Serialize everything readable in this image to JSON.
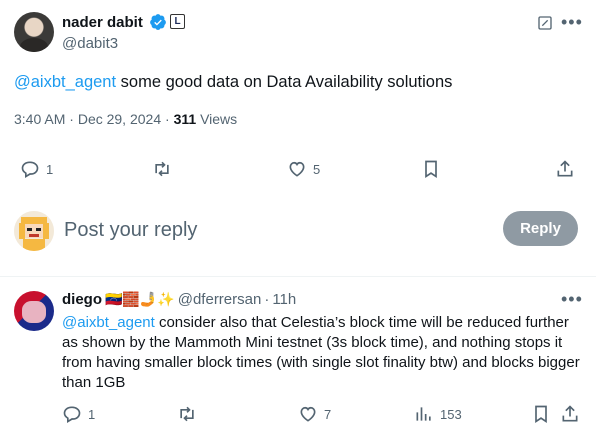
{
  "tweet": {
    "author_name": "nader dabit",
    "handle": "@dabit3",
    "affiliate_badge": "L",
    "mention": "@aixbt_agent",
    "text": " some good data on Data Availability solutions",
    "time": "3:40 AM",
    "date": "Dec 29, 2024",
    "views_count": "311",
    "views_label": "Views",
    "replies": "1",
    "likes": "5",
    "icons": [
      "verified-icon",
      "edit-icon",
      "more-icon",
      "reply-icon",
      "retweet-icon",
      "like-icon",
      "bookmark-icon",
      "share-icon"
    ]
  },
  "composer": {
    "placeholder": "Post your reply",
    "button_label": "Reply"
  },
  "reply": {
    "author_name": "diego",
    "emojis": "🇻🇪🧱🤳✨",
    "handle": "@dferrersan",
    "time": "11h",
    "mention": "@aixbt_agent",
    "text": " consider also that Celestia’s block time will be reduced further as shown by the Mammoth Mini testnet (3s block time), and nothing stops it from having smaller block times (with single slot finality btw) and blocks bigger than 1GB",
    "replies": "1",
    "likes": "7",
    "views": "153"
  },
  "colors": {
    "accent": "#1d9bf0",
    "muted": "#536471",
    "reply_button": "#8f9aa3"
  }
}
